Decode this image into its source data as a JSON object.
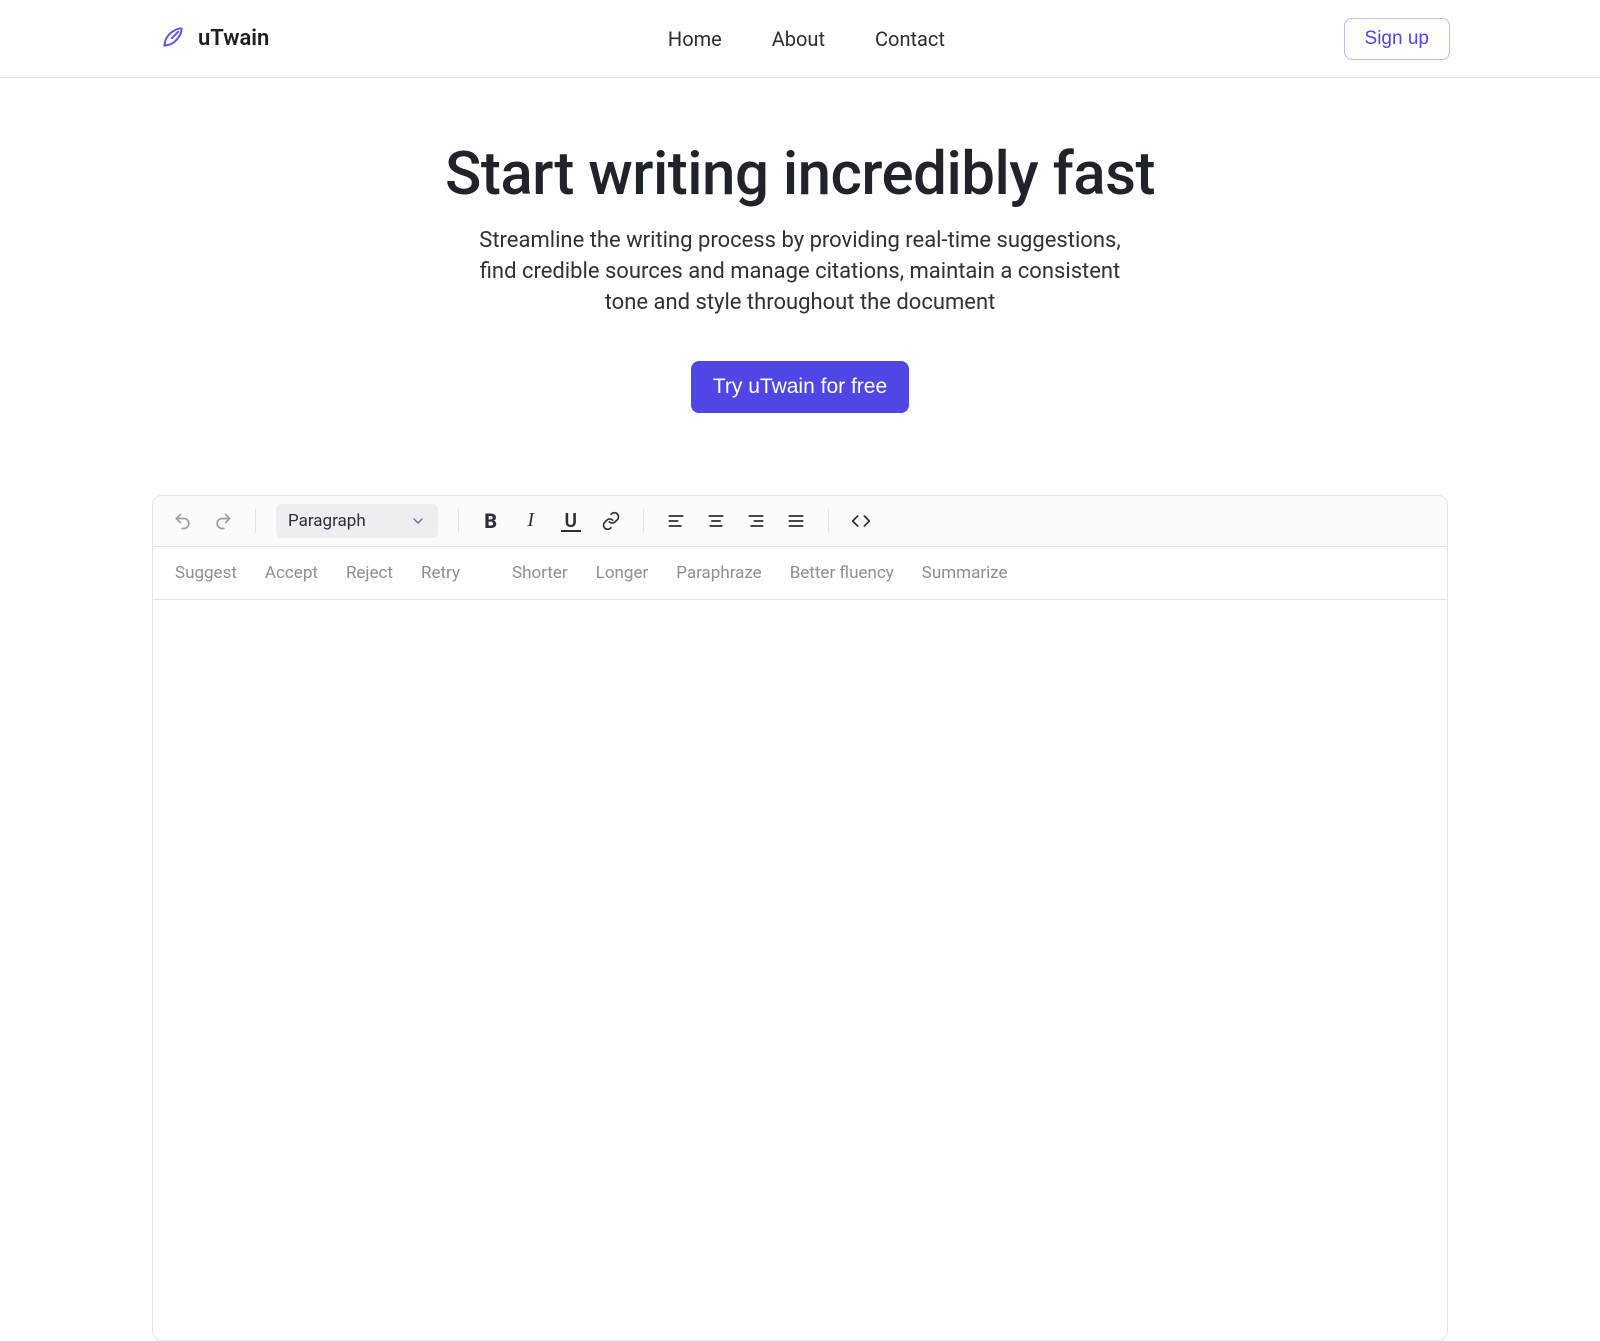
{
  "brand": {
    "name": "uTwain"
  },
  "nav": {
    "items": [
      {
        "label": "Home"
      },
      {
        "label": "About"
      },
      {
        "label": "Contact"
      }
    ],
    "signup": "Sign up"
  },
  "hero": {
    "title": "Start writing incredibly fast",
    "subtitle": "Streamline the writing process by providing real-time suggestions, find credible sources and manage citations, maintain a consistent tone and style throughout the document",
    "cta": "Try uTwain for free"
  },
  "toolbar": {
    "paragraph_label": "Paragraph"
  },
  "ai_actions": {
    "suggest": "Suggest",
    "accept": "Accept",
    "reject": "Reject",
    "retry": "Retry",
    "shorter": "Shorter",
    "longer": "Longer",
    "paraphraze": "Paraphraze",
    "fluency": "Better fluency",
    "summarize": "Summarize"
  }
}
